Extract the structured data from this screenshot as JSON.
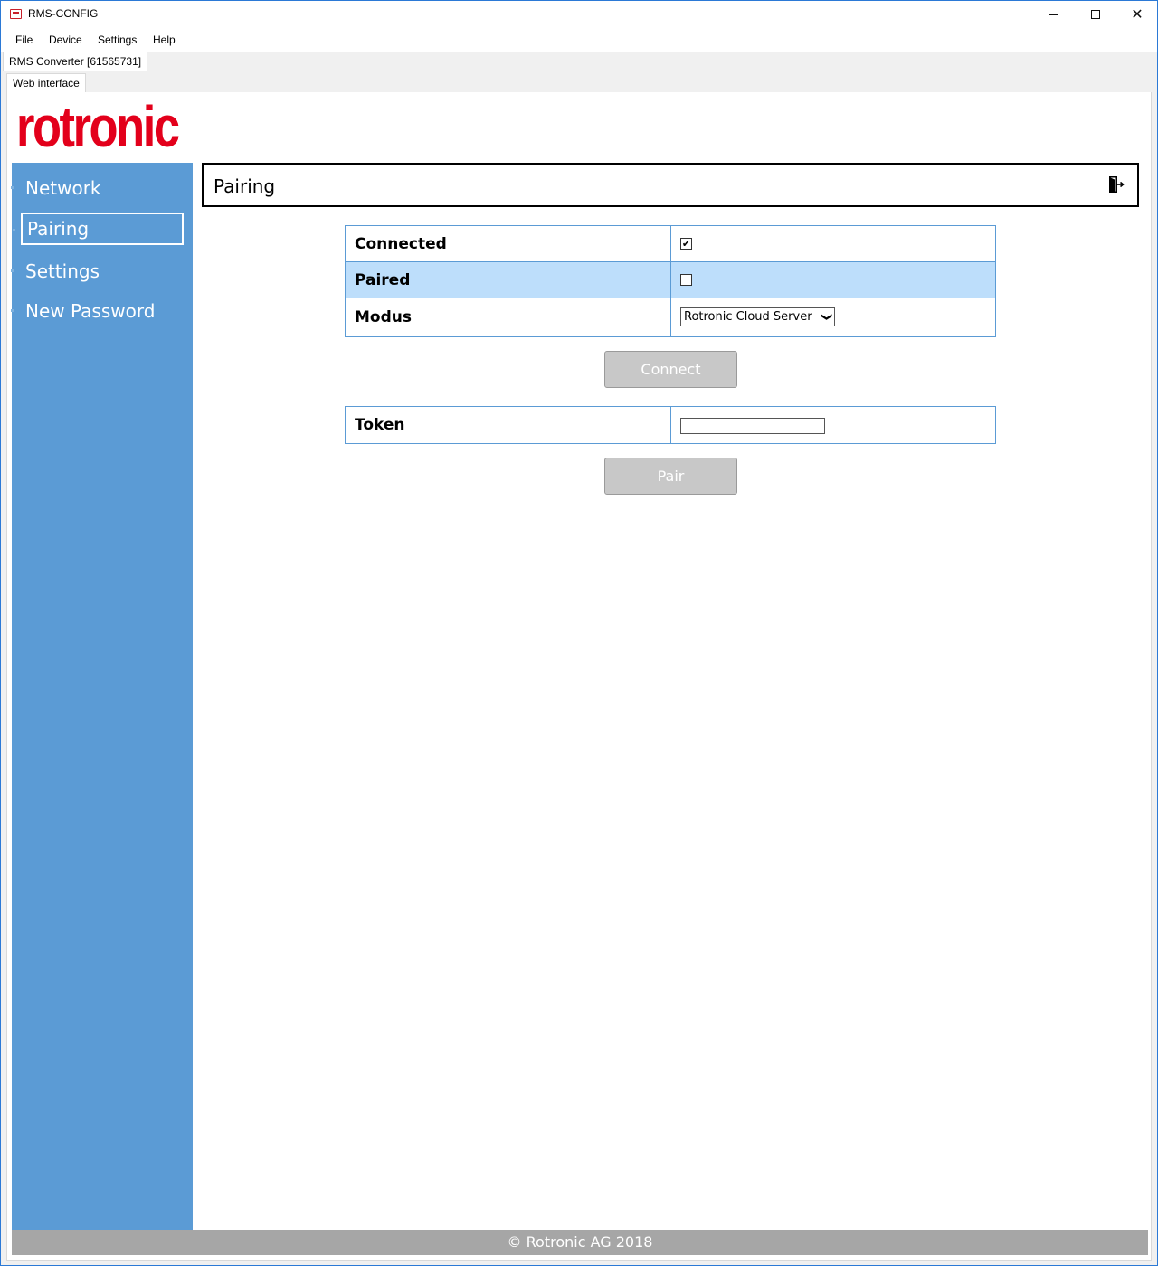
{
  "window": {
    "title": "RMS-CONFIG",
    "close_glyph": "✕"
  },
  "menu": [
    "File",
    "Device",
    "Settings",
    "Help"
  ],
  "tabs": {
    "device_tab": "RMS Converter [61565731]",
    "sub_tab": "Web interface"
  },
  "brand": {
    "logo_text": "rotronic",
    "logo_color": "#e3001b",
    "accent": "#5b9bd5"
  },
  "sidebar": {
    "items": [
      {
        "label": "Network"
      },
      {
        "label": "Pairing",
        "active": true
      },
      {
        "label": "Settings"
      },
      {
        "label": "New Password"
      }
    ]
  },
  "page": {
    "title": "Pairing",
    "logout_icon": "logout-icon"
  },
  "status_table": {
    "rows": [
      {
        "label": "Connected",
        "checked": true,
        "mark": "✔"
      },
      {
        "label": "Paired",
        "checked": false,
        "mark": ""
      },
      {
        "label": "Modus",
        "value": "Rotronic Cloud Server",
        "chevron": "❯"
      }
    ]
  },
  "connect_button": "Connect",
  "token_table": {
    "label": "Token",
    "value": ""
  },
  "pair_button": "Pair",
  "footer": "© Rotronic AG 2018"
}
